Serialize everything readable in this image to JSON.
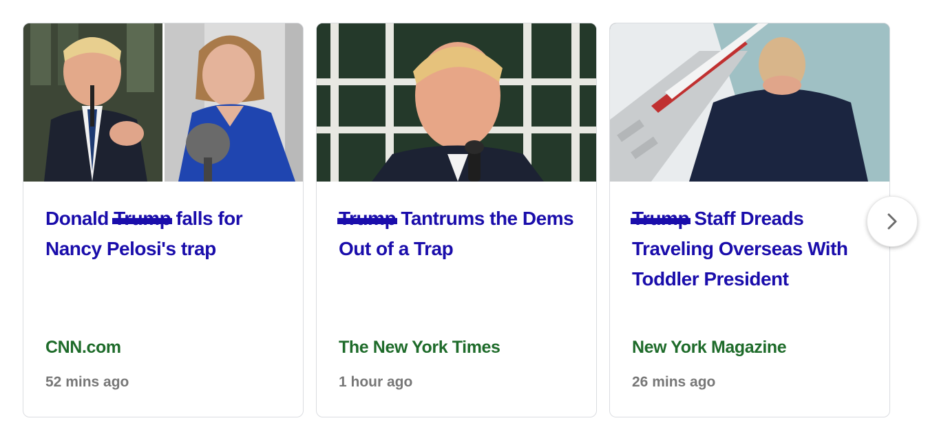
{
  "cards": [
    {
      "headline_pre": "Donald ",
      "headline_redacted": "Trump",
      "headline_post": " falls for Nancy Pelosi's trap",
      "source": "CNN.com",
      "time": "52 mins ago"
    },
    {
      "headline_pre": "",
      "headline_redacted": "Trump",
      "headline_post": " Tantrums the Dems Out of a Trap",
      "source": "The New York Times",
      "time": "1 hour ago"
    },
    {
      "headline_pre": "",
      "headline_redacted": "Trump",
      "headline_post": " Staff Dreads Traveling Overseas With Toddler President",
      "source": "New York Magazine",
      "time": "26 mins ago"
    }
  ],
  "icons": {
    "next": "chevron-right-icon"
  },
  "colors": {
    "headline": "#1a0dab",
    "source": "#1e6b2a",
    "time": "#777777",
    "card_border": "#dadce0"
  }
}
